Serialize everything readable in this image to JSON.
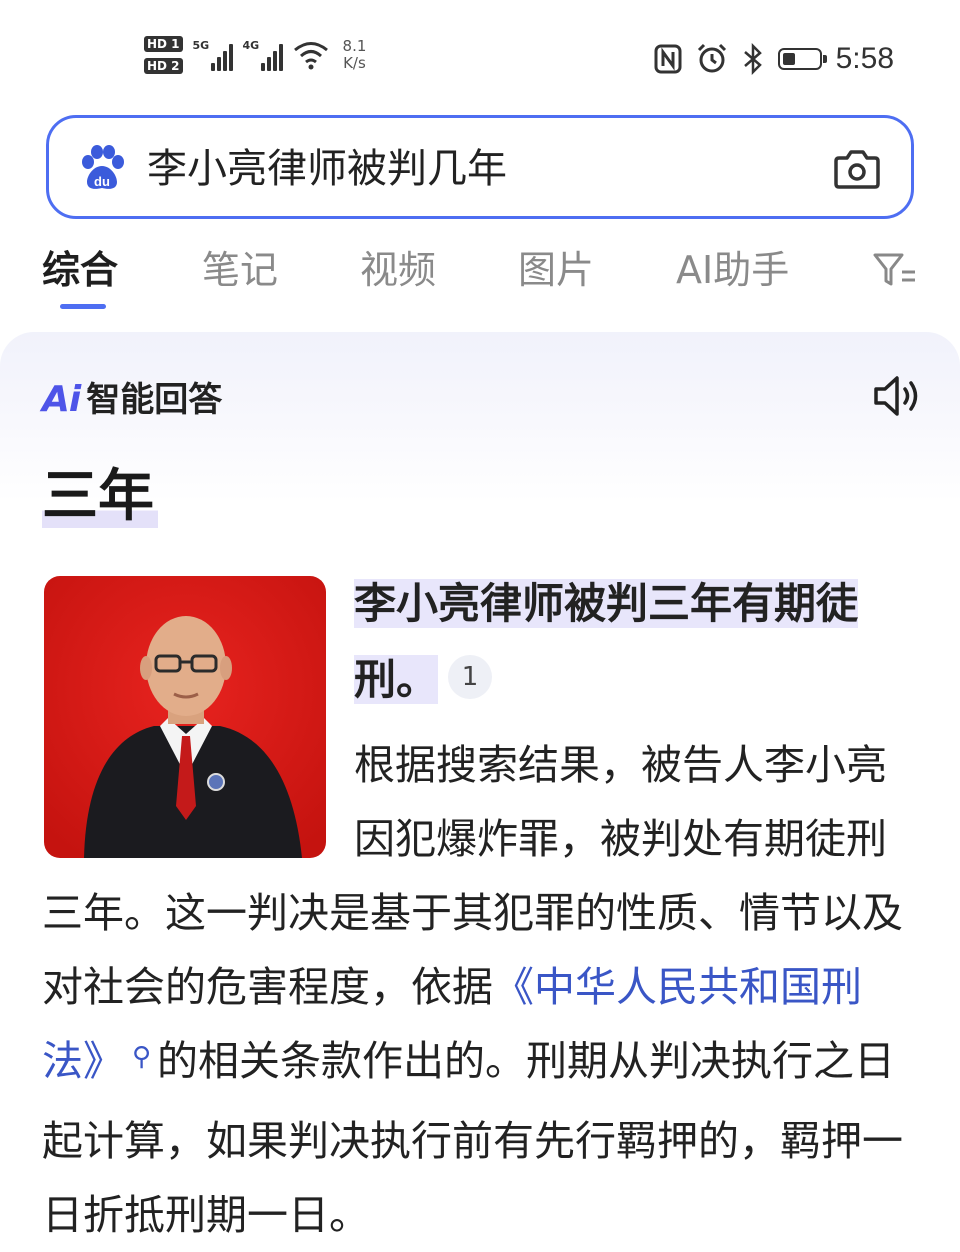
{
  "status_bar": {
    "hd1": "HD 1",
    "hd2": "HD 2",
    "net1": "5G",
    "net2": "4G",
    "speed_value": "8.1",
    "speed_unit": "K/s",
    "battery_level": 0.35,
    "time": "5:58",
    "icons": [
      "nfc-icon",
      "alarm-icon",
      "bluetooth-icon",
      "battery-icon"
    ]
  },
  "search": {
    "query": "李小亮律师被判几年",
    "logo_text": "du"
  },
  "tabs": [
    {
      "label": "综合",
      "active": true
    },
    {
      "label": "笔记",
      "active": false
    },
    {
      "label": "视频",
      "active": false
    },
    {
      "label": "图片",
      "active": false
    },
    {
      "label": "AI助手",
      "active": false
    }
  ],
  "ai_answer": {
    "logo": "Ai",
    "title": "智能回答",
    "headline": "三年",
    "summary_line1": "李小亮律师被判三年有期徒",
    "summary_line2": "刑。",
    "citation": "1",
    "body_part1": "根据搜索结果，被告人李小亮因犯爆炸罪，被判处有期徒刑三年。这一判决是基于其犯罪的性质、情节以及对社会的危害程度，依据",
    "law_link": "《中华人民共和国刑法》",
    "body_part2": "的相关条款作出的。刑期从判决执行之日起计算，如果判决执行前有先行羁押的，羁押一日折抵刑期一日。"
  },
  "colors": {
    "accent": "#4e6ef2",
    "ai_purple": "#4e54e8",
    "link": "#3a56c6",
    "highlight": "#e8e6fb"
  }
}
